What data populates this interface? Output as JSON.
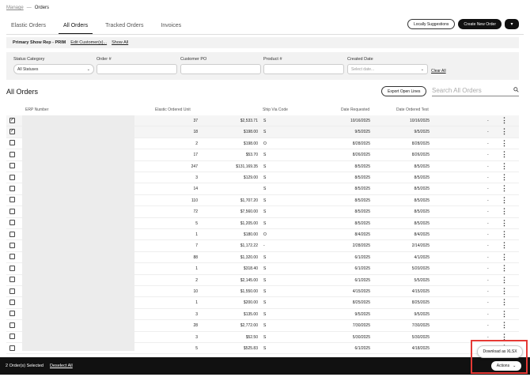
{
  "breadcrumb": {
    "parent": "Manage",
    "separator": "—",
    "current": "Orders"
  },
  "tabs": [
    {
      "label": "Elastic Orders",
      "active": false
    },
    {
      "label": "All Orders",
      "active": true
    },
    {
      "label": "Tracked Orders",
      "active": false
    },
    {
      "label": "Invoices",
      "active": false
    }
  ],
  "top_actions": {
    "suggestions": "Locally Suggestions",
    "create": "Create New Order",
    "dropdown": "▾"
  },
  "rep_bar": {
    "title": "Primary Show Rep - PRIM",
    "edit": "Edit Customer(s)...",
    "show_all": "Show All"
  },
  "filters": {
    "status": {
      "label": "Status Category",
      "value": "All Statuses"
    },
    "order": {
      "label": "Order #",
      "value": ""
    },
    "po": {
      "label": "Customer PO",
      "value": ""
    },
    "product": {
      "label": "Product #",
      "value": ""
    },
    "created": {
      "label": "Created Date",
      "placeholder": "Select date..."
    },
    "clear": "Clear All"
  },
  "orders": {
    "title": "All Orders",
    "export": "Export Open Lines",
    "search_placeholder": "Search All Orders"
  },
  "columns": {
    "erp": "ERP Number",
    "elastic": "Elastic Ordered Unit",
    "ship": "Ship Via Code",
    "requested": "Date Requested",
    "ordered": "Date Ordered Test"
  },
  "rows": [
    {
      "checked": true,
      "qty": "37",
      "amount": "$2,533.71",
      "ship": "S",
      "req": "10/16/2025",
      "ord": "10/16/2025",
      "dash": "-"
    },
    {
      "checked": true,
      "qty": "18",
      "amount": "$198.00",
      "ship": "S",
      "req": "9/5/2025",
      "ord": "9/5/2025",
      "dash": "-"
    },
    {
      "checked": false,
      "qty": "2",
      "amount": "$198.00",
      "ship": "O",
      "req": "8/28/2025",
      "ord": "8/28/2025",
      "dash": "-"
    },
    {
      "checked": false,
      "qty": "17",
      "amount": "$53.70",
      "ship": "S",
      "req": "8/26/2025",
      "ord": "8/26/2025",
      "dash": "-"
    },
    {
      "checked": false,
      "qty": "247",
      "amount": "$131,169.35",
      "ship": "S",
      "req": "8/5/2025",
      "ord": "8/5/2025",
      "dash": "-"
    },
    {
      "checked": false,
      "qty": "3",
      "amount": "$129.00",
      "ship": "S",
      "req": "8/5/2025",
      "ord": "8/5/2025",
      "dash": "-"
    },
    {
      "checked": false,
      "qty": "14",
      "amount": "",
      "ship": "S",
      "req": "8/5/2025",
      "ord": "8/5/2025",
      "dash": "-"
    },
    {
      "checked": false,
      "qty": "110",
      "amount": "$1,707.20",
      "ship": "S",
      "req": "8/5/2025",
      "ord": "8/5/2025",
      "dash": "-"
    },
    {
      "checked": false,
      "qty": "72",
      "amount": "$7,560.00",
      "ship": "S",
      "req": "8/5/2025",
      "ord": "8/5/2025",
      "dash": "-"
    },
    {
      "checked": false,
      "qty": "5",
      "amount": "$1,205.00",
      "ship": "S",
      "req": "8/5/2025",
      "ord": "8/5/2025",
      "dash": "-"
    },
    {
      "checked": false,
      "qty": "1",
      "amount": "$180.00",
      "ship": "O",
      "req": "8/4/2025",
      "ord": "8/4/2025",
      "dash": "-"
    },
    {
      "checked": false,
      "qty": "7",
      "amount": "$1,172.22",
      "ship": "-",
      "req": "2/28/2025",
      "ord": "2/14/2025",
      "dash": "-"
    },
    {
      "checked": false,
      "qty": "88",
      "amount": "$1,320.00",
      "ship": "S",
      "req": "6/1/2025",
      "ord": "4/1/2025",
      "dash": "-"
    },
    {
      "checked": false,
      "qty": "1",
      "amount": "$318.40",
      "ship": "S",
      "req": "6/1/2025",
      "ord": "5/20/2025",
      "dash": "-"
    },
    {
      "checked": false,
      "qty": "2",
      "amount": "$2,145.00",
      "ship": "S",
      "req": "6/1/2025",
      "ord": "5/5/2025",
      "dash": "-"
    },
    {
      "checked": false,
      "qty": "10",
      "amount": "$1,550.00",
      "ship": "S",
      "req": "4/15/2025",
      "ord": "4/15/2025",
      "dash": "-"
    },
    {
      "checked": false,
      "qty": "1",
      "amount": "$200.00",
      "ship": "S",
      "req": "8/25/2025",
      "ord": "8/25/2025",
      "dash": "-"
    },
    {
      "checked": false,
      "qty": "3",
      "amount": "$135.00",
      "ship": "S",
      "req": "9/5/2025",
      "ord": "9/5/2025",
      "dash": "-"
    },
    {
      "checked": false,
      "qty": "28",
      "amount": "$2,772.00",
      "ship": "S",
      "req": "7/30/2025",
      "ord": "7/30/2025",
      "dash": "-"
    },
    {
      "checked": false,
      "qty": "3",
      "amount": "$52.50",
      "ship": "S",
      "req": "5/30/2025",
      "ord": "5/30/2025",
      "dash": "-"
    },
    {
      "checked": false,
      "qty": "5",
      "amount": "$525.83",
      "ship": "S",
      "req": "6/1/2025",
      "ord": "4/18/2025",
      "dash": "-"
    }
  ],
  "bottom_bar": {
    "selected": "2 Order(s) Selected",
    "deselect": "Deselect All"
  },
  "popup": {
    "download": "Download as XLSX"
  },
  "actions": {
    "label": "Actions",
    "chevron": "⌄"
  },
  "colors": {
    "highlight": "#e53935",
    "dark": "#111111",
    "panel": "#f2f2f2"
  }
}
